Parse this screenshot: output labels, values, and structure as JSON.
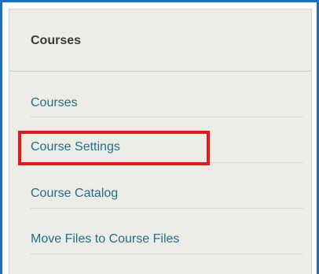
{
  "panel": {
    "title": "Courses"
  },
  "menu": {
    "items": [
      {
        "label": "Courses"
      },
      {
        "label": "Course Settings"
      },
      {
        "label": "Course Catalog"
      },
      {
        "label": "Move Files to Course Files"
      }
    ]
  },
  "annotation": {
    "highlight_color": "#e8161d",
    "highlighted_item": "Course Settings"
  },
  "colors": {
    "frame_border": "#1d6fb8",
    "panel_background": "#eeece6",
    "link": "#1e6f8f",
    "title": "#3a3a3a"
  }
}
